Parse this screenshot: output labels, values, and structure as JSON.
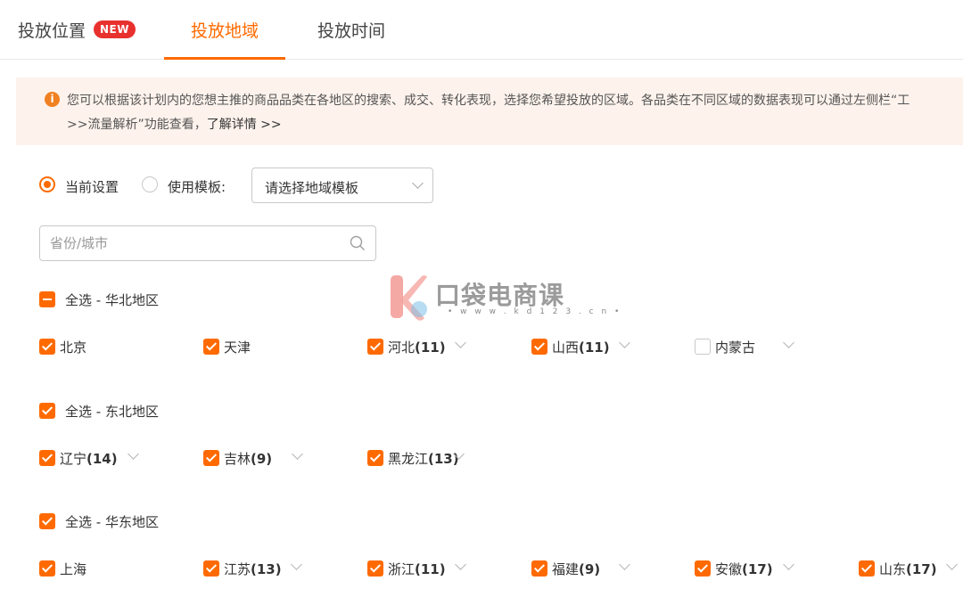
{
  "tabs": [
    {
      "label": "投放位置",
      "badge": "NEW"
    },
    {
      "label": "投放地域"
    },
    {
      "label": "投放时间"
    }
  ],
  "notice": {
    "line1": "您可以根据该计划内的您想主推的商品品类在各地区的搜索、成交、转化表现，选择您希望投放的区域。各品类在不同区域的数据表现可以通过左侧栏“工",
    "line2": ">>流量解析”功能查看，",
    "link": "了解详情 >>"
  },
  "mode": {
    "current_label": "当前设置",
    "template_label": "使用模板:",
    "template_placeholder": "请选择地域模板"
  },
  "search": {
    "placeholder": "省份/城市"
  },
  "regions": [
    {
      "label": "全选 - 华北地区",
      "items": [
        {
          "name": "北京",
          "count": ""
        },
        {
          "name": "天津",
          "count": ""
        },
        {
          "name": "河北",
          "count": "(11)"
        },
        {
          "name": "山西",
          "count": "(11)"
        },
        {
          "name": "内蒙古",
          "count": ""
        }
      ]
    },
    {
      "label": "全选 - 东北地区",
      "items": [
        {
          "name": "辽宁",
          "count": "(14)"
        },
        {
          "name": "吉林",
          "count": "(9)"
        },
        {
          "name": "黑龙江",
          "count": "(13)"
        }
      ]
    },
    {
      "label": "全选 - 华东地区",
      "items": [
        {
          "name": "上海",
          "count": ""
        },
        {
          "name": "江苏",
          "count": "(13)"
        },
        {
          "name": "浙江",
          "count": "(11)"
        },
        {
          "name": "福建",
          "count": "(9)"
        },
        {
          "name": "安徽",
          "count": "(17)"
        },
        {
          "name": "山东",
          "count": "(17)"
        }
      ]
    }
  ],
  "watermark": {
    "text": "口袋电商课",
    "url": "• w w w . k d 1 2 3 . c n •"
  },
  "colors": {
    "accent": "#ff6a00",
    "badge": "#e8312f",
    "notice_bg": "#fdf2ec"
  }
}
